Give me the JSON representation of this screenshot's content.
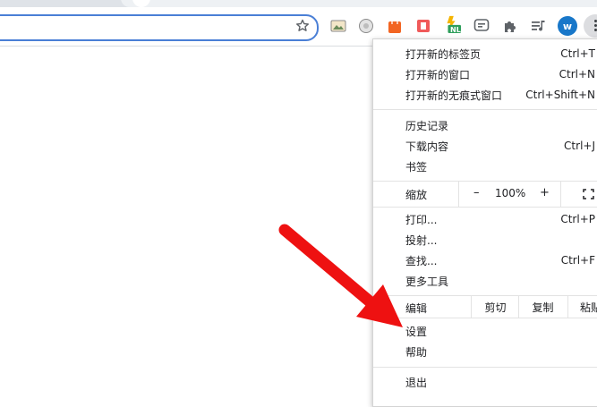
{
  "toolbar": {
    "extensions": [
      "image-icon",
      "cookie-icon",
      "shopping-bag-icon",
      "red-book-icon",
      "nl-badge-icon",
      "chat-icon",
      "puzzle-icon",
      "media-queue-icon"
    ],
    "nl_badge_text": "NL",
    "profile_initial": "w"
  },
  "menu": {
    "items": [
      {
        "label": "打开新的标签页",
        "shortcut": "Ctrl+T"
      },
      {
        "label": "打开新的窗口",
        "shortcut": "Ctrl+N"
      },
      {
        "label": "打开新的无痕式窗口",
        "shortcut": "Ctrl+Shift+N"
      },
      {
        "label": "历史记录",
        "shortcut": ""
      },
      {
        "label": "下载内容",
        "shortcut": "Ctrl+J"
      },
      {
        "label": "书签",
        "shortcut": ""
      },
      {
        "label": "打印...",
        "shortcut": "Ctrl+P"
      },
      {
        "label": "投射...",
        "shortcut": ""
      },
      {
        "label": "查找...",
        "shortcut": "Ctrl+F"
      },
      {
        "label": "更多工具",
        "shortcut": ""
      },
      {
        "label": "设置",
        "shortcut": ""
      },
      {
        "label": "帮助",
        "shortcut": ""
      },
      {
        "label": "退出",
        "shortcut": ""
      }
    ],
    "zoom": {
      "label": "缩放",
      "minus": "–",
      "value": "100%",
      "plus": "+"
    },
    "edit": {
      "label": "编辑",
      "cut": "剪切",
      "copy": "复制",
      "paste": "粘贴"
    }
  },
  "annotation": {
    "arrow_color": "#ee1111"
  }
}
